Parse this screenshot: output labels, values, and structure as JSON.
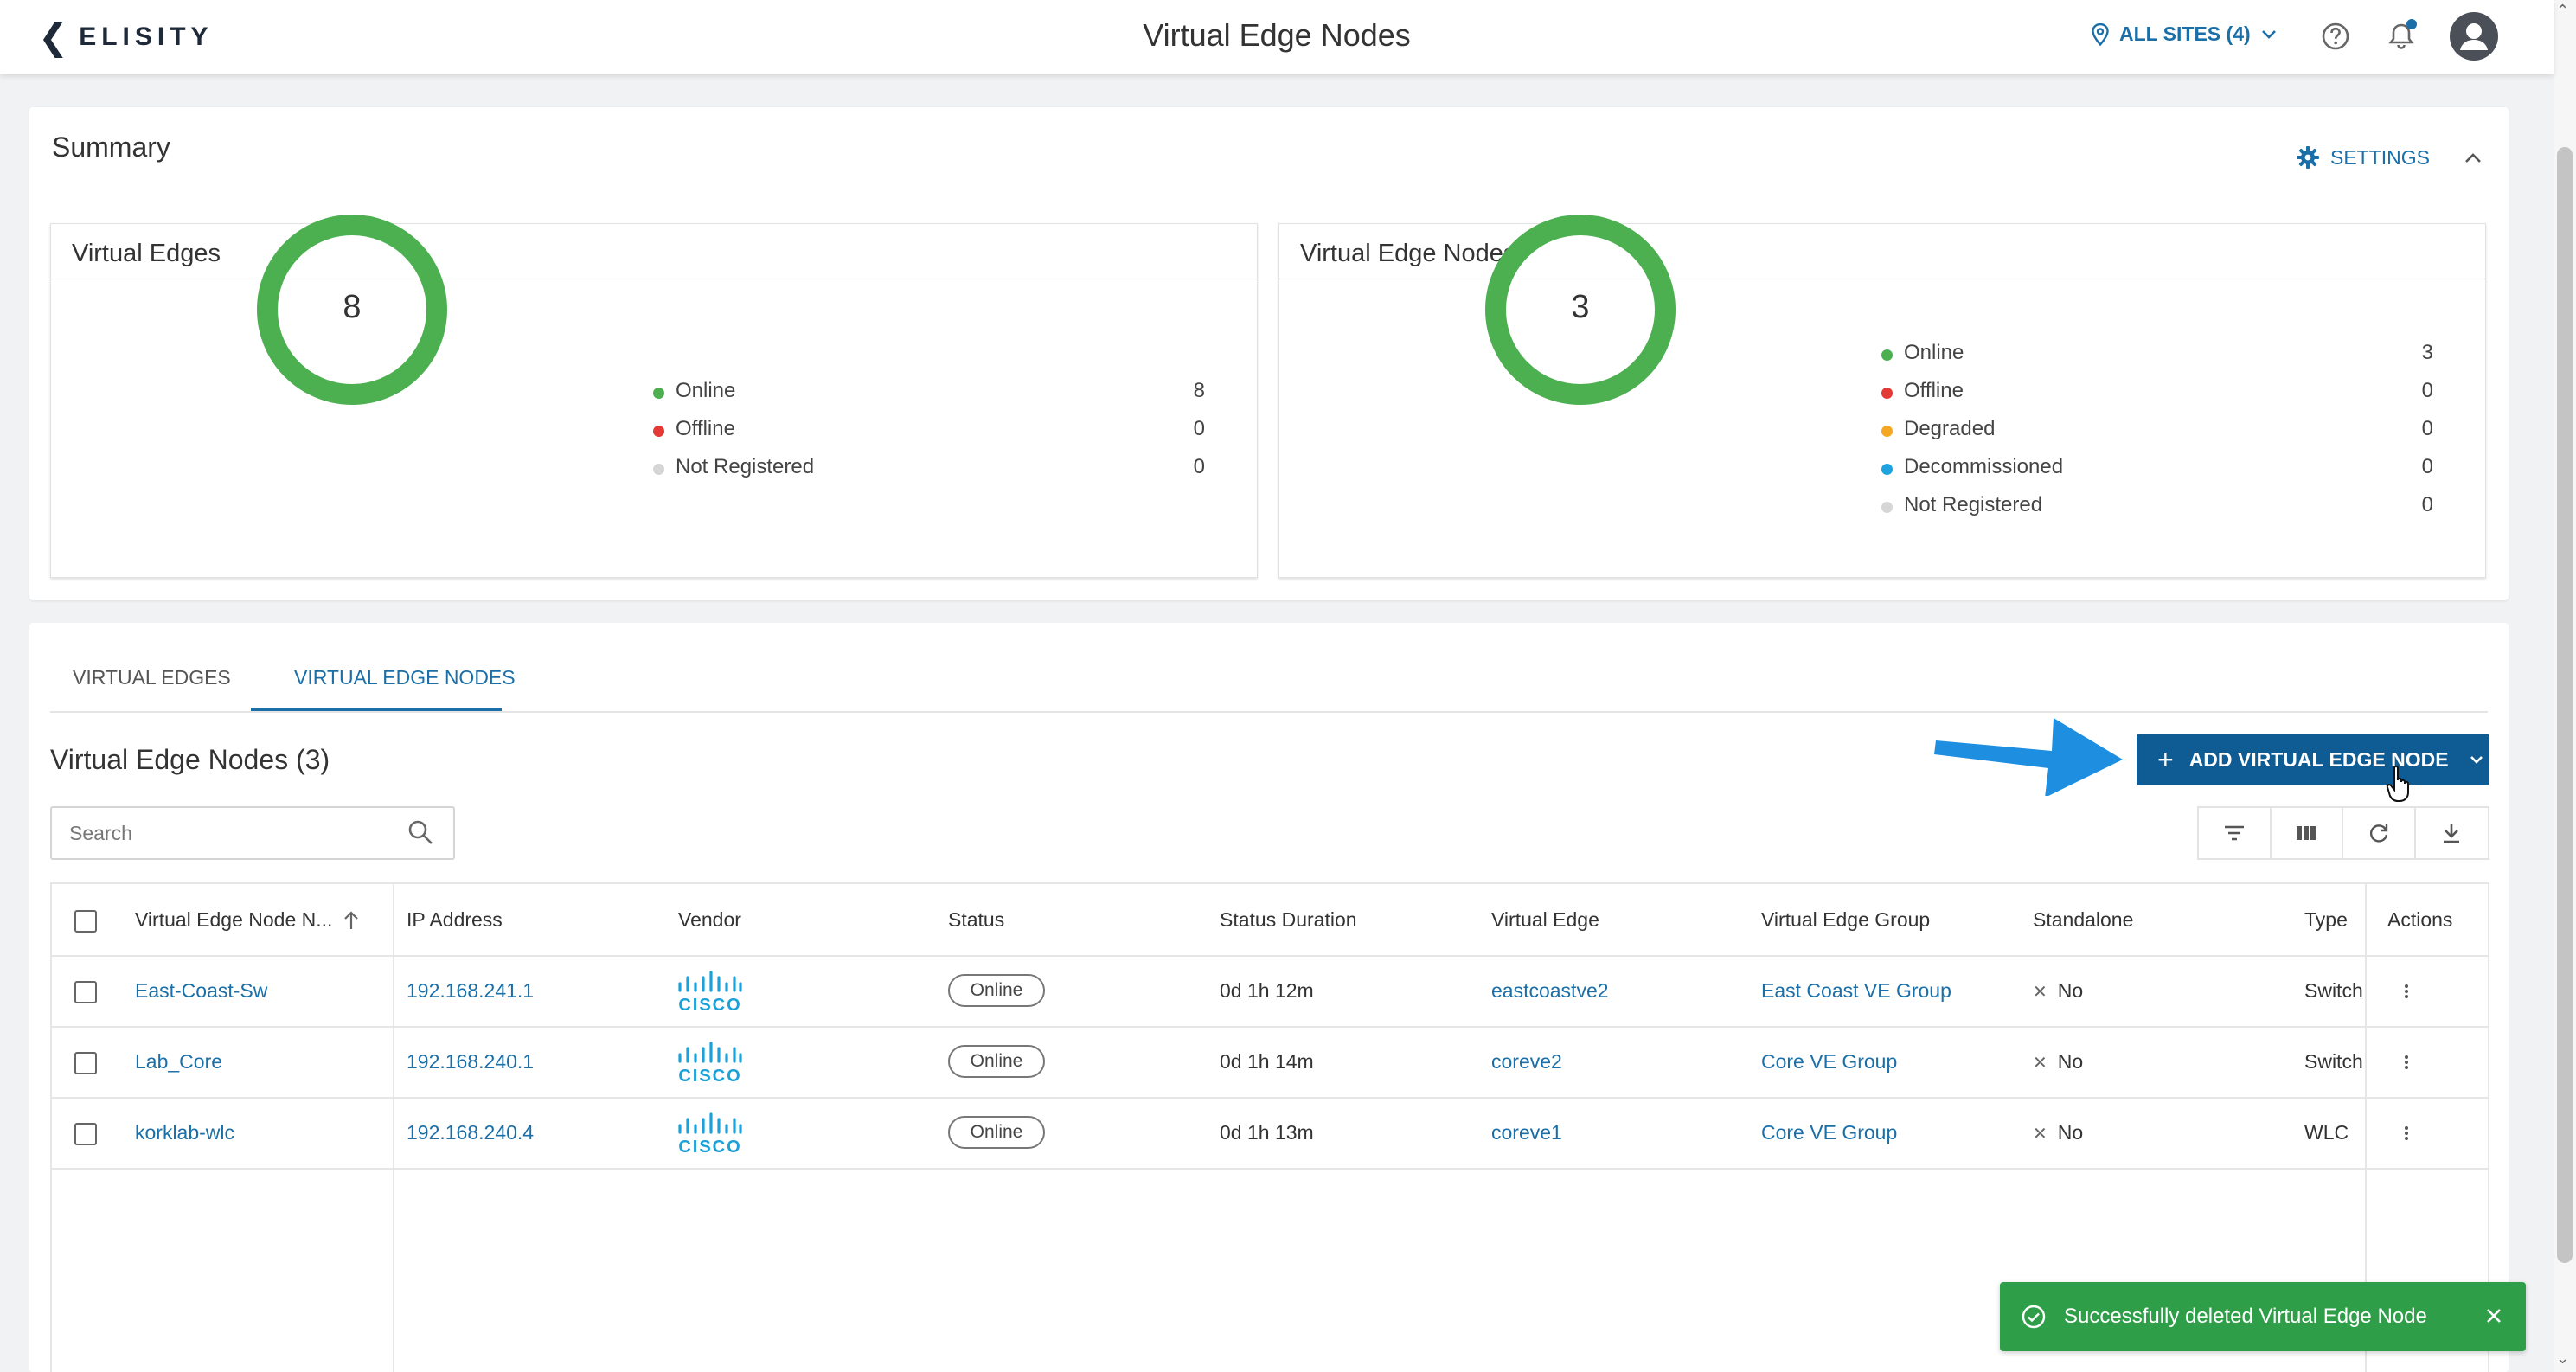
{
  "header": {
    "logo_text": "ELISITY",
    "title": "Virtual Edge Nodes",
    "site_selector": "ALL SITES (4)"
  },
  "summary": {
    "title": "Summary",
    "settings_label": "SETTINGS",
    "virtual_edges": {
      "title": "Virtual Edges",
      "total": "8",
      "legend": [
        {
          "label": "Online",
          "value": "8",
          "color": "#4caf50"
        },
        {
          "label": "Offline",
          "value": "0",
          "color": "#e53935"
        },
        {
          "label": "Not Registered",
          "value": "0",
          "color": "#d6d6d6"
        }
      ]
    },
    "virtual_edge_nodes": {
      "title": "Virtual Edge Nodes",
      "total": "3",
      "legend": [
        {
          "label": "Online",
          "value": "3",
          "color": "#4caf50"
        },
        {
          "label": "Offline",
          "value": "0",
          "color": "#e53935"
        },
        {
          "label": "Degraded",
          "value": "0",
          "color": "#f5a623"
        },
        {
          "label": "Decommissioned",
          "value": "0",
          "color": "#1ea2e0"
        },
        {
          "label": "Not Registered",
          "value": "0",
          "color": "#d6d6d6"
        }
      ]
    }
  },
  "tabs": [
    "VIRTUAL EDGES",
    "VIRTUAL EDGE NODES"
  ],
  "table": {
    "title": "Virtual Edge Nodes (3)",
    "add_button": "ADD VIRTUAL EDGE NODE",
    "search_placeholder": "Search",
    "columns": [
      "Virtual Edge Node N...",
      "IP Address",
      "Vendor",
      "Status",
      "Status Duration",
      "Virtual Edge",
      "Virtual Edge Group",
      "Standalone",
      "Type",
      "Actions"
    ],
    "rows": [
      {
        "name": "East-Coast-Sw",
        "ip": "192.168.241.1",
        "vendor": "CISCO",
        "status": "Online",
        "duration": "0d 1h 12m",
        "virtual_edge": "eastcoastve2",
        "group": "East Coast VE Group",
        "standalone": "No",
        "type": "Switch"
      },
      {
        "name": "Lab_Core",
        "ip": "192.168.240.1",
        "vendor": "CISCO",
        "status": "Online",
        "duration": "0d 1h 14m",
        "virtual_edge": "coreve2",
        "group": "Core VE Group",
        "standalone": "No",
        "type": "Switch"
      },
      {
        "name": "korklab-wlc",
        "ip": "192.168.240.4",
        "vendor": "CISCO",
        "status": "Online",
        "duration": "0d 1h 13m",
        "virtual_edge": "coreve1",
        "group": "Core VE Group",
        "standalone": "No",
        "type": "WLC"
      }
    ]
  },
  "toast": {
    "message": "Successfully deleted Virtual Edge Node",
    "color": "#2e9e48"
  },
  "colors": {
    "accent": "#1a6fa8",
    "primary_button": "#0f5c94",
    "online": "#4caf50"
  }
}
